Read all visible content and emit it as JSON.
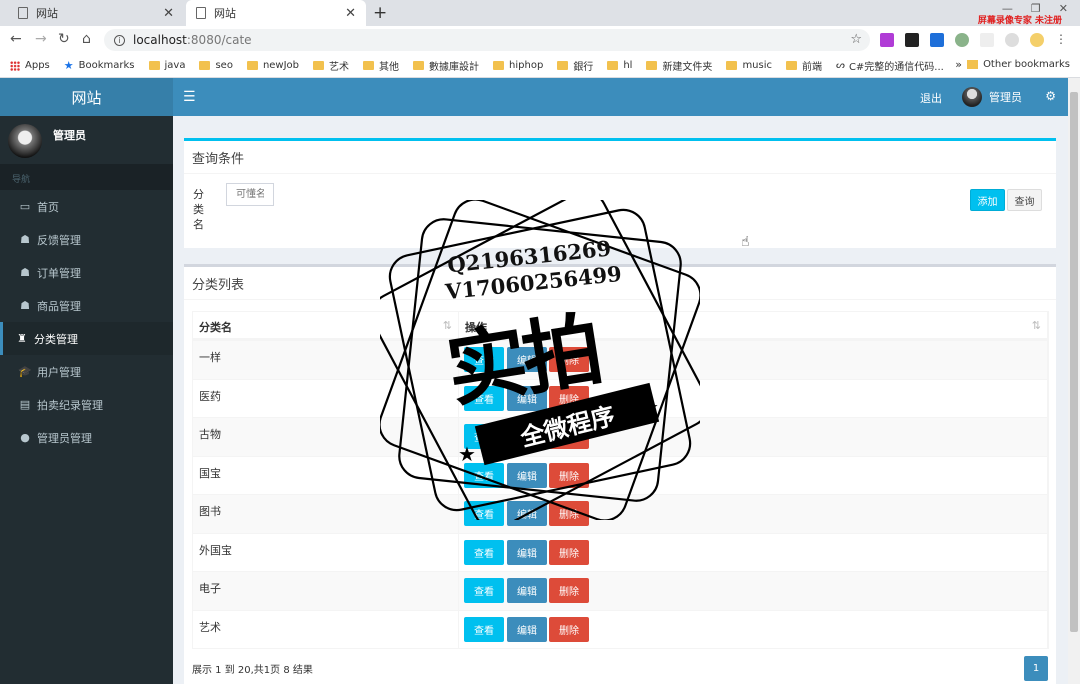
{
  "browser": {
    "tabs": [
      {
        "title": "网站",
        "active": false
      },
      {
        "title": "网站",
        "active": true
      }
    ],
    "new_tab_symbol": "+",
    "recorder_label": "屏幕录像专家 未注册",
    "url_host": "localhost",
    "url_path": ":8080/cate",
    "bookmarks": [
      {
        "label": "Apps",
        "icon": "apps-icon"
      },
      {
        "label": "Bookmarks",
        "icon": "star-icon"
      },
      {
        "label": "java",
        "icon": "folder-icon"
      },
      {
        "label": "seo",
        "icon": "folder-icon"
      },
      {
        "label": "newJob",
        "icon": "folder-icon"
      },
      {
        "label": "艺术",
        "icon": "folder-icon"
      },
      {
        "label": "其他",
        "icon": "folder-icon"
      },
      {
        "label": "數據庫設計",
        "icon": "folder-icon"
      },
      {
        "label": "hiphop",
        "icon": "folder-icon"
      },
      {
        "label": "銀行",
        "icon": "folder-icon"
      },
      {
        "label": "hl",
        "icon": "folder-icon"
      },
      {
        "label": "新建文件夹",
        "icon": "folder-icon"
      },
      {
        "label": "music",
        "icon": "folder-icon"
      },
      {
        "label": "前端",
        "icon": "folder-icon"
      },
      {
        "label": "C#完整的通信代码...",
        "icon": "web-icon"
      }
    ],
    "bookmarks_more": "»",
    "other_bookmarks": "Other bookmarks"
  },
  "app": {
    "logo": "网站",
    "logout": "退出",
    "user_name": "管理员"
  },
  "sidebar": {
    "user_name": "管理员",
    "header": "导航",
    "items": [
      {
        "label": "首页",
        "icon": "▭",
        "active": false
      },
      {
        "label": "反馈管理",
        "icon": "☗",
        "active": false
      },
      {
        "label": "订单管理",
        "icon": "☗",
        "active": false
      },
      {
        "label": "商品管理",
        "icon": "☗",
        "active": false
      },
      {
        "label": "分类管理",
        "icon": "♜",
        "active": true
      },
      {
        "label": "用户管理",
        "icon": "🎓",
        "active": false
      },
      {
        "label": "拍卖纪录管理",
        "icon": "▤",
        "active": false
      },
      {
        "label": "管理员管理",
        "icon": "●",
        "active": false
      }
    ]
  },
  "query": {
    "title": "查询条件",
    "field_label": "分类名",
    "field_placeholder": "可懂名",
    "add_button": "添加",
    "search_button": "查询"
  },
  "list": {
    "title": "分类列表",
    "columns": [
      "分类名",
      "操作"
    ],
    "rows": [
      "一样",
      "医药",
      "古物",
      "国宝",
      "图书",
      "外国宝",
      "电子",
      "艺术"
    ],
    "view_label": "查看",
    "edit_label": "编辑",
    "delete_label": "删除",
    "pager_info": "展示 1 到 20,共1页 8 结果",
    "current_page": "1"
  },
  "watermark": {
    "line1": "Q2196316269",
    "line2": "V17060256499",
    "big_text": "实拍",
    "ribbon_text": "全微程序"
  },
  "colors": {
    "header_blue": "#3c8dbc",
    "logo_blue": "#367fa9",
    "sidebar_dark": "#222d32",
    "info": "#00c0ef",
    "danger": "#dd4b39"
  }
}
